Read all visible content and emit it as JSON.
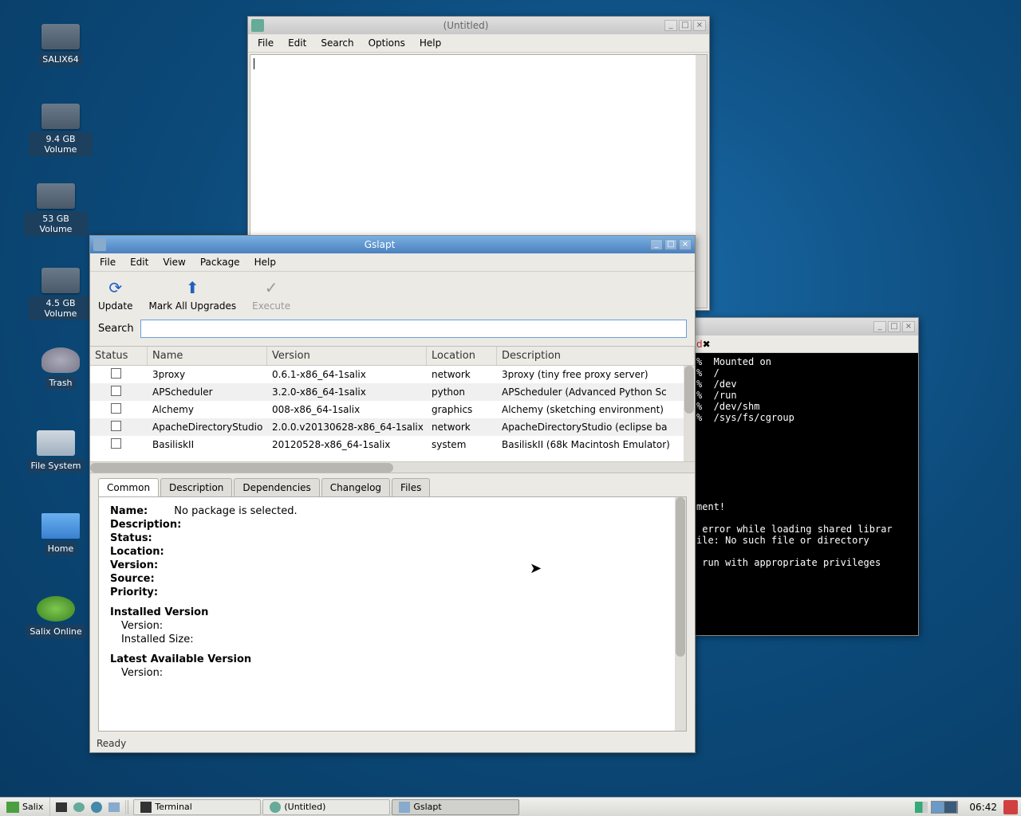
{
  "desktop": {
    "icons": [
      {
        "label": "SALIX64"
      },
      {
        "label": "9.4 GB Volume"
      },
      {
        "label": "53 GB Volume"
      },
      {
        "label": "4.5 GB Volume"
      },
      {
        "label": "Trash"
      },
      {
        "label": "File System"
      },
      {
        "label": "Home"
      },
      {
        "label": "Salix Online"
      }
    ]
  },
  "editor": {
    "title": "(Untitled)",
    "menu": [
      "File",
      "Edit",
      "Search",
      "Options",
      "Help"
    ]
  },
  "terminal": {
    "tab": "d",
    "lines": "%  Mounted on\n%  /\n%  /dev\n%  /run\n%  /dev/shm\n%  /sys/fs/cgroup\n\n\n\n\n\n\n\nment!\n\n error while loading shared librar\nile: No such file or directory\n\n run with appropriate privileges\n"
  },
  "gslapt": {
    "title": "Gslapt",
    "menu": [
      "File",
      "Edit",
      "View",
      "Package",
      "Help"
    ],
    "tools": {
      "update": "Update",
      "mark": "Mark All Upgrades",
      "exec": "Execute"
    },
    "search_label": "Search",
    "columns": {
      "status": "Status",
      "name": "Name",
      "version": "Version",
      "location": "Location",
      "description": "Description"
    },
    "rows": [
      {
        "name": "3proxy",
        "version": "0.6.1-x86_64-1salix",
        "location": "network",
        "desc": "3proxy (tiny free proxy server)"
      },
      {
        "name": "APScheduler",
        "version": "3.2.0-x86_64-1salix",
        "location": "python",
        "desc": "APScheduler (Advanced Python Sc"
      },
      {
        "name": "Alchemy",
        "version": "008-x86_64-1salix",
        "location": "graphics",
        "desc": "Alchemy (sketching environment)"
      },
      {
        "name": "ApacheDirectoryStudio",
        "version": "2.0.0.v20130628-x86_64-1salix",
        "location": "network",
        "desc": "ApacheDirectoryStudio (eclipse ba"
      },
      {
        "name": "BasiliskII",
        "version": "20120528-x86_64-1salix",
        "location": "system",
        "desc": "BasiliskII (68k Macintosh Emulator)"
      }
    ],
    "tabs": [
      "Common",
      "Description",
      "Dependencies",
      "Changelog",
      "Files"
    ],
    "detail": {
      "name_label": "Name:",
      "name_value": "No package is selected.",
      "desc_label": "Description:",
      "status_label": "Status:",
      "loc_label": "Location:",
      "ver_label": "Version:",
      "src_label": "Source:",
      "pri_label": "Priority:",
      "inst_head": "Installed Version",
      "inst_ver": "Version:",
      "inst_size": "Installed Size:",
      "latest_head": "Latest Available Version",
      "latest_ver": "Version:"
    },
    "status": "Ready"
  },
  "taskbar": {
    "start": "Salix",
    "tasks": [
      {
        "label": "Terminal"
      },
      {
        "label": "(Untitled)"
      },
      {
        "label": "Gslapt"
      }
    ],
    "clock": "06:42"
  }
}
